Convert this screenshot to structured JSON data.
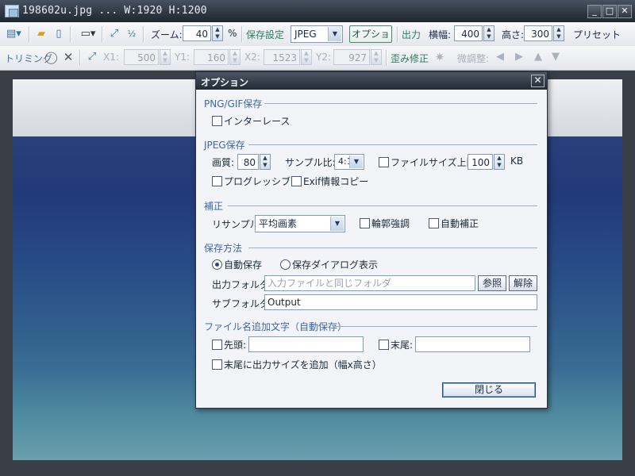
{
  "window": {
    "title": "198602u.jpg ... W:1920 H:1200",
    "minimize": "_",
    "maximize": "□",
    "close": "✕"
  },
  "toolbar1": {
    "zoom_label": "ズーム:",
    "zoom_value": "40",
    "zoom_unit": "%",
    "save_settings_label": "保存設定",
    "format_value": "JPEG",
    "options_button": "オプション",
    "output_label": "出力",
    "width_label": "横幅:",
    "width_value": "400",
    "height_label": "高さ:",
    "height_value": "300",
    "preset_label": "プリセット"
  },
  "toolbar2": {
    "trimming_label": "トリミング",
    "x1_label": "X1:",
    "x1_value": "500",
    "y1_label": "Y1:",
    "y1_value": "160",
    "x2_label": "X2:",
    "x2_value": "1523",
    "y2_label": "Y2:",
    "y2_value": "927",
    "distortion_label": "歪み修正",
    "fine_adjust_label": "微調整:"
  },
  "dialog": {
    "title": "オプション",
    "close": "✕",
    "png_section": "PNG/GIF保存",
    "interlace": {
      "label": "インターレース",
      "checked": false
    },
    "jpeg_section": "JPEG保存",
    "quality_label": "画質:",
    "quality_value": "80",
    "sampling_label": "サンプル比:",
    "sampling_value": "4:1",
    "filesize_limit": {
      "label": "ファイルサイズ上限:",
      "checked": false
    },
    "filesize_value": "100",
    "filesize_unit": "KB",
    "progressive": {
      "label": "プログレッシブ",
      "checked": false
    },
    "exif_copy": {
      "label": "Exif情報コピー",
      "checked": false
    },
    "correction_section": "補正",
    "resample_label": "リサンプル:",
    "resample_value": "平均画素",
    "edge_enhance": {
      "label": "輪郭強調",
      "checked": false
    },
    "auto_correct": {
      "label": "自動補正",
      "checked": false
    },
    "save_method_section": "保存方法",
    "auto_save": {
      "label": "自動保存",
      "selected": true
    },
    "save_dialog": {
      "label": "保存ダイアログ表示",
      "selected": false
    },
    "output_folder_label": "出力フォルダ:",
    "output_folder_placeholder": "入力ファイルと同じフォルダ",
    "browse_button": "参照",
    "clear_button": "解除",
    "subfolder_label": "サブフォルダ:",
    "subfolder_value": "Output",
    "filename_section": "ファイル名追加文字（自動保存）",
    "prefix": {
      "label": "先頭:",
      "checked": false,
      "value": ""
    },
    "suffix": {
      "label": "末尾:",
      "checked": false,
      "value": ""
    },
    "append_size": {
      "label": "末尾に出力サイズを追加（幅x高さ）",
      "checked": false
    },
    "close_button": "閉じる"
  }
}
